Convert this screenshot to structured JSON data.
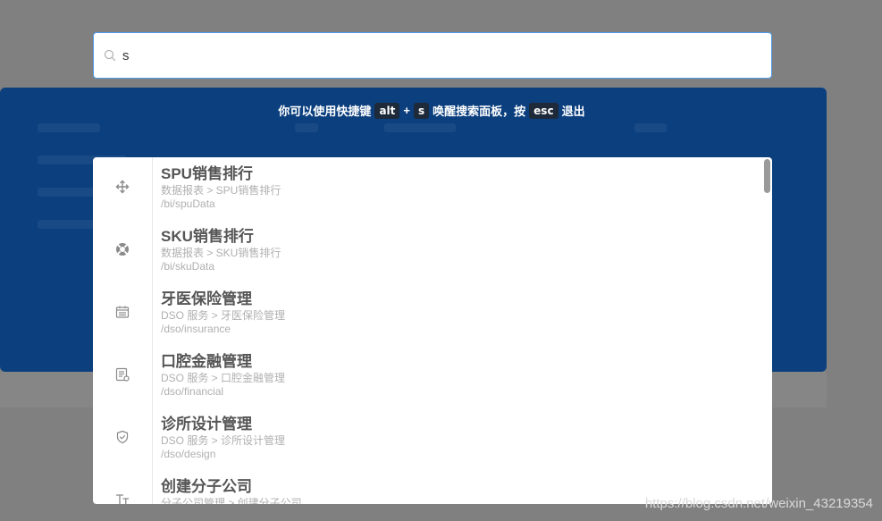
{
  "search": {
    "value": "s",
    "icon": "search-icon"
  },
  "hint": {
    "prefix": "你可以使用快捷键",
    "key1": "alt",
    "plus": "+",
    "key2": "s",
    "middle": "唤醒搜索面板，按",
    "key3": "esc",
    "suffix": "退出"
  },
  "results": [
    {
      "title": "SPU销售排行",
      "crumb": "数据报表 > SPU销售排行",
      "path": "/bi/spuData",
      "icon": "move-icon"
    },
    {
      "title": "SKU销售排行",
      "crumb": "数据报表 > SKU销售排行",
      "path": "/bi/skuData",
      "icon": "lifebuoy-icon"
    },
    {
      "title": "牙医保险管理",
      "crumb": "DSO 服务 > 牙医保险管理",
      "path": "/dso/insurance",
      "icon": "calendar-icon"
    },
    {
      "title": "口腔金融管理",
      "crumb": "DSO 服务 > 口腔金融管理",
      "path": "/dso/financial",
      "icon": "invoice-icon"
    },
    {
      "title": "诊所设计管理",
      "crumb": "DSO 服务 > 诊所设计管理",
      "path": "/dso/design",
      "icon": "shield-check-icon"
    },
    {
      "title": "创建分子公司",
      "crumb": "分子公司管理 > 创建分子公司",
      "path": "",
      "icon": "text-size-icon"
    }
  ],
  "watermark": "https://blog.csdn.net/weixin_43219354",
  "colors": {
    "overlay": "#808080",
    "panel_blue": "#0b3f7e",
    "input_border": "#4f9be8",
    "kbd_bg": "#1e2a3a",
    "title_text": "#555555",
    "sub_text": "#b0b0b0"
  }
}
